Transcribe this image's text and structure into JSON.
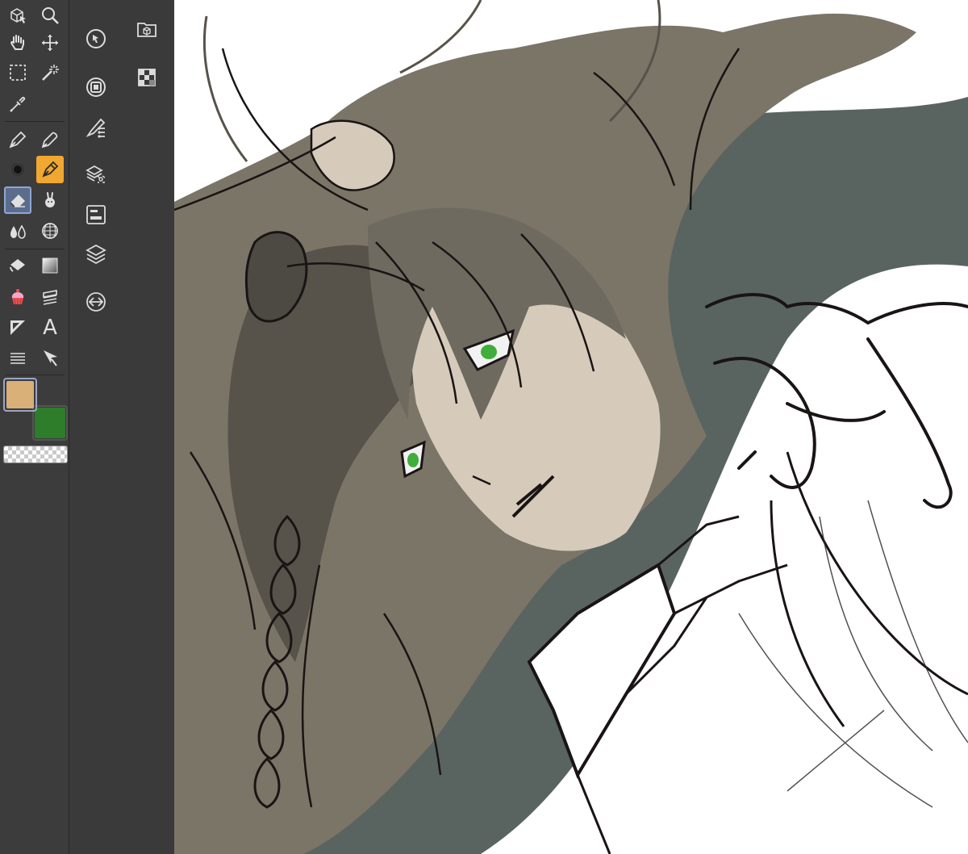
{
  "tool_palette": {
    "tools": [
      {
        "name": "sub-view",
        "icon": "cube-cursor-icon"
      },
      {
        "name": "zoom",
        "icon": "magnifier-icon"
      },
      {
        "name": "hand",
        "icon": "hand-icon"
      },
      {
        "name": "move",
        "icon": "move-arrows-icon"
      },
      {
        "name": "selection",
        "icon": "marquee-icon"
      },
      {
        "name": "auto-select",
        "icon": "magic-wand-icon"
      },
      {
        "name": "eyedropper",
        "icon": "eyedropper-icon"
      },
      {
        "name": "pen",
        "icon": "pen-nib-icon"
      },
      {
        "name": "pencil",
        "icon": "pencil-nib-icon"
      },
      {
        "name": "airbrush",
        "icon": "airbrush-dot-icon"
      },
      {
        "name": "decoration",
        "icon": "decoration-pen-icon",
        "state": "highlight"
      },
      {
        "name": "eraser",
        "icon": "eraser-icon",
        "state": "selected"
      },
      {
        "name": "blend",
        "icon": "rabbit-icon"
      },
      {
        "name": "brush",
        "icon": "droplets-icon"
      },
      {
        "name": "figure",
        "icon": "grid-sphere-icon"
      },
      {
        "name": "fill",
        "icon": "bucket-icon"
      },
      {
        "name": "gradient",
        "icon": "gradient-square-icon"
      },
      {
        "name": "ruler",
        "icon": "cupcake-icon"
      },
      {
        "name": "frame",
        "icon": "layers-frame-icon"
      },
      {
        "name": "operation",
        "icon": "triangle-ruler-icon"
      },
      {
        "name": "text",
        "icon": "text-icon",
        "label": "A"
      },
      {
        "name": "balloon",
        "icon": "lines-icon"
      },
      {
        "name": "correct-line",
        "icon": "arrow-cursor-icon"
      }
    ]
  },
  "colors": {
    "main": "#d8b078",
    "sub": "#2e7d2a",
    "accent_highlight": "#f0a830",
    "selected_bg": "#5c6c8c"
  },
  "palette_bar": {
    "buttons": [
      {
        "name": "navigator",
        "icon": "navigator-icon"
      },
      {
        "name": "material",
        "icon": "folder-cube-icon"
      },
      {
        "name": "color-circle",
        "icon": "color-ring-icon"
      },
      {
        "name": "color-set",
        "icon": "color-set-grid-icon"
      },
      {
        "name": "tool-property",
        "icon": "brush-settings-icon"
      },
      {
        "name": "sub-tool-detail",
        "icon": "layers-property-icon"
      },
      {
        "name": "layer-property",
        "icon": "panel-icon"
      },
      {
        "name": "layer",
        "icon": "stack-layers-icon"
      },
      {
        "name": "history",
        "icon": "arrows-circle-icon"
      }
    ]
  },
  "canvas": {
    "subject": "sketch-illustration",
    "palette": {
      "hair": "#7b7568",
      "hair_dark": "#57524a",
      "skin": "#d6cbbb",
      "background_shade": "#596460",
      "eye": "#3fae3a",
      "line": "#1a1414"
    }
  }
}
